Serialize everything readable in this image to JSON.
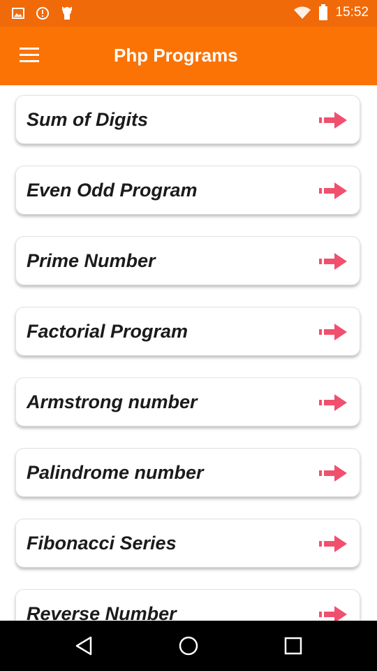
{
  "status_bar": {
    "time": "15:52",
    "icons": [
      "image-icon",
      "notification-icon",
      "android-icon",
      "wifi-icon",
      "battery-icon"
    ]
  },
  "app_bar": {
    "title": "Php Programs",
    "menu_icon": "hamburger-menu-icon",
    "background": "#fb7305"
  },
  "programs": [
    {
      "label": "Sum of Digits"
    },
    {
      "label": "Even Odd Program"
    },
    {
      "label": "Prime Number"
    },
    {
      "label": "Factorial Program"
    },
    {
      "label": "Armstrong number"
    },
    {
      "label": "Palindrome number"
    },
    {
      "label": "Fibonacci Series"
    },
    {
      "label": "Reverse Number"
    }
  ],
  "arrow_icon": "right-arrow-icon",
  "arrow_color": "#f0506e",
  "nav_bar": {
    "buttons": [
      "back-icon",
      "home-icon",
      "recents-icon"
    ]
  }
}
